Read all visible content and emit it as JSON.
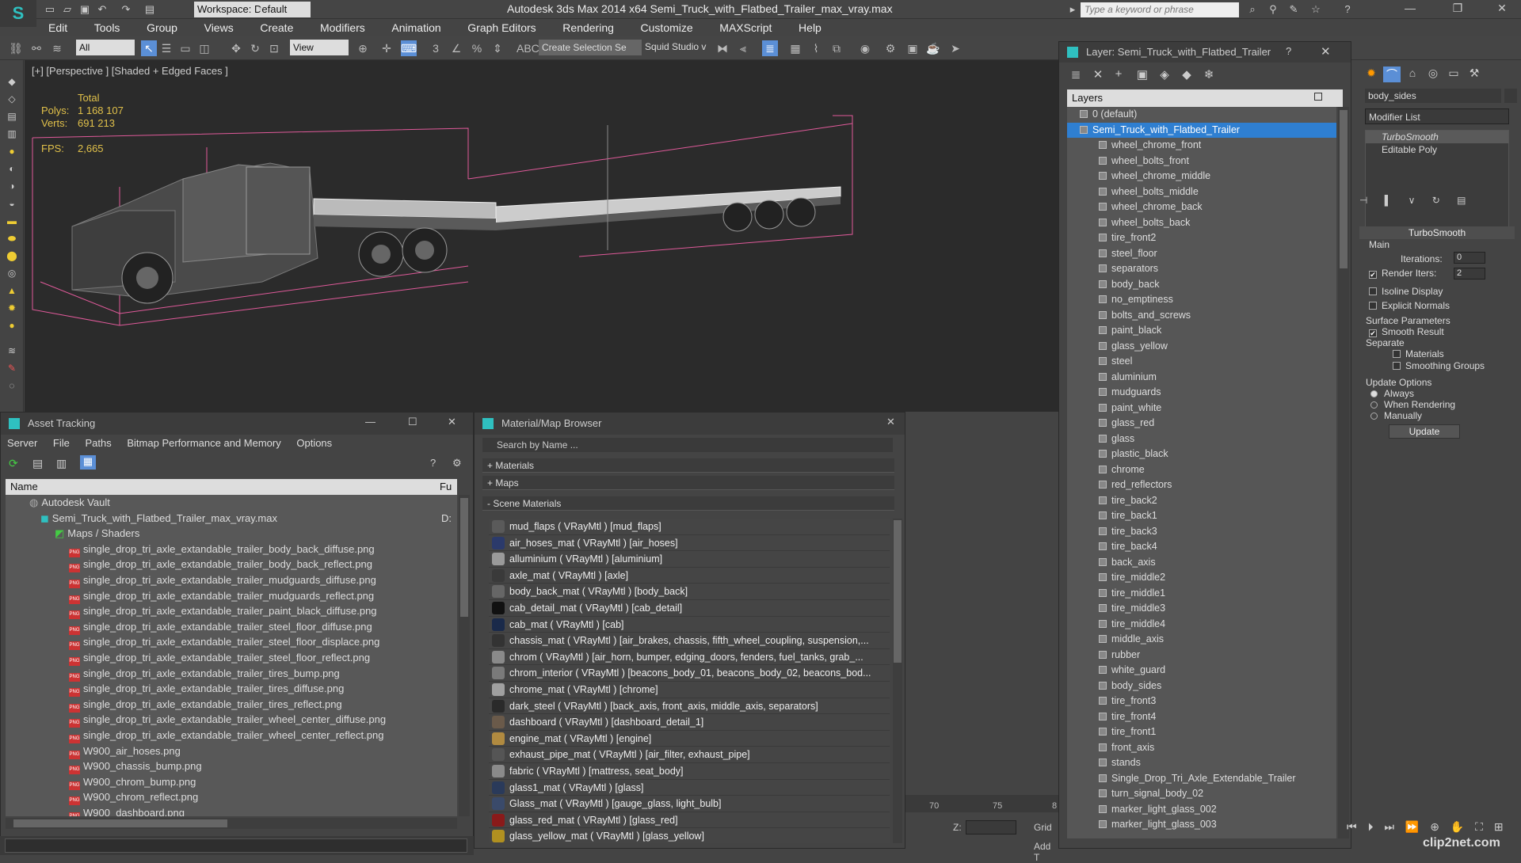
{
  "app": {
    "title": "Autodesk 3ds Max  2014 x64     Semi_Truck_with_Flatbed_Trailer_max_vray.max",
    "workspace": "Workspace: Default",
    "search_placeholder": "Type a keyword or phrase"
  },
  "menu": [
    "Edit",
    "Tools",
    "Group",
    "Views",
    "Create",
    "Modifiers",
    "Animation",
    "Graph Editors",
    "Rendering",
    "Customize",
    "MAXScript",
    "Help"
  ],
  "toolbar": {
    "filter": "All",
    "coord": "View",
    "selection_set": "Create Selection Se",
    "squid": "Squid Studio v"
  },
  "viewport": {
    "label": "[+] [Perspective ] [Shaded + Edged Faces ]",
    "stats_total": "Total",
    "polys_label": "Polys:",
    "polys": "1 168 107",
    "verts_label": "Verts:",
    "verts": "691 213",
    "fps_label": "FPS:",
    "fps": "2,665"
  },
  "layer_window": {
    "title": "Layer: Semi_Truck_with_Flatbed_Trailer",
    "header": "Layers",
    "top_items": [
      "0 (default)",
      "Semi_Truck_with_Flatbed_Trailer"
    ],
    "items": [
      "wheel_chrome_front",
      "wheel_bolts_front",
      "wheel_chrome_middle",
      "wheel_bolts_middle",
      "wheel_chrome_back",
      "wheel_bolts_back",
      "tire_front2",
      "steel_floor",
      "separators",
      "body_back",
      "no_emptiness",
      "bolts_and_screws",
      "paint_black",
      "glass_yellow",
      "steel",
      "aluminium",
      "mudguards",
      "paint_white",
      "glass_red",
      "glass",
      "plastic_black",
      "chrome",
      "red_reflectors",
      "tire_back2",
      "tire_back1",
      "tire_back3",
      "tire_back4",
      "back_axis",
      "tire_middle2",
      "tire_middle1",
      "tire_middle3",
      "tire_middle4",
      "middle_axis",
      "rubber",
      "white_guard",
      "body_sides",
      "tire_front3",
      "tire_front4",
      "tire_front1",
      "front_axis",
      "stands",
      "Single_Drop_Tri_Axle_Extendable_Trailer",
      "turn_signal_body_02",
      "marker_light_glass_002",
      "marker_light_glass_003"
    ]
  },
  "command_panel": {
    "object_name": "body_sides",
    "modifier_list": "Modifier List",
    "stack": [
      "TurboSmooth",
      "Editable Poly"
    ],
    "rollout_title": "TurboSmooth",
    "main_label": "Main",
    "iterations_label": "Iterations:",
    "iterations": "0",
    "render_iters_label": "Render Iters:",
    "render_iters": "2",
    "isoline": "Isoline Display",
    "explicit_normals": "Explicit Normals",
    "surface_params": "Surface Parameters",
    "smooth_result": "Smooth Result",
    "separate": "Separate",
    "materials": "Materials",
    "smoothing_groups": "Smoothing Groups",
    "update_options": "Update Options",
    "always": "Always",
    "when_rendering": "When Rendering",
    "manually": "Manually",
    "update_button": "Update"
  },
  "asset_tracking": {
    "title": "Asset Tracking",
    "menu": [
      "Server",
      "File",
      "Paths",
      "Bitmap Performance and Memory",
      "Options"
    ],
    "col_name": "Name",
    "col_fu": "Fu",
    "vault": "Autodesk Vault",
    "file": "Semi_Truck_with_Flatbed_Trailer_max_vray.max",
    "file_suffix": "D:",
    "maps_folder": "Maps / Shaders",
    "maps": [
      "single_drop_tri_axle_extandable_trailer_body_back_diffuse.png",
      "single_drop_tri_axle_extandable_trailer_body_back_reflect.png",
      "single_drop_tri_axle_extandable_trailer_mudguards_diffuse.png",
      "single_drop_tri_axle_extandable_trailer_mudguards_reflect.png",
      "single_drop_tri_axle_extandable_trailer_paint_black_diffuse.png",
      "single_drop_tri_axle_extandable_trailer_steel_floor_diffuse.png",
      "single_drop_tri_axle_extandable_trailer_steel_floor_displace.png",
      "single_drop_tri_axle_extandable_trailer_steel_floor_reflect.png",
      "single_drop_tri_axle_extandable_trailer_tires_bump.png",
      "single_drop_tri_axle_extandable_trailer_tires_diffuse.png",
      "single_drop_tri_axle_extandable_trailer_tires_reflect.png",
      "single_drop_tri_axle_extandable_trailer_wheel_center_diffuse.png",
      "single_drop_tri_axle_extandable_trailer_wheel_center_reflect.png",
      "W900_air_hoses.png",
      "W900_chassis_bump.png",
      "W900_chrom_bump.png",
      "W900_chrom_reflect.png",
      "W900_dashboard.png"
    ]
  },
  "material_browser": {
    "title": "Material/Map Browser",
    "search": "Search by Name ...",
    "cat_materials": "+ Materials",
    "cat_maps": "+ Maps",
    "cat_scene": "- Scene Materials",
    "items": [
      {
        "t": "mud_flaps  ( VRayMtl ) [mud_flaps]",
        "c": "#5a5a5a"
      },
      {
        "t": "air_hoses_mat  ( VRayMtl ) [air_hoses]",
        "c": "#2b3a6b"
      },
      {
        "t": "alluminium  ( VRayMtl ) [aluminium]",
        "c": "#9a9a9a"
      },
      {
        "t": "axle_mat  ( VRayMtl ) [axle]",
        "c": "#3a3a3a"
      },
      {
        "t": "body_back_mat  ( VRayMtl ) [body_back]",
        "c": "#666666"
      },
      {
        "t": "cab_detail_mat  ( VRayMtl ) [cab_detail]",
        "c": "#111111"
      },
      {
        "t": "cab_mat  ( VRayMtl ) [cab]",
        "c": "#1a2a4a"
      },
      {
        "t": "chassis_mat  ( VRayMtl ) [air_brakes, chassis, fifth_wheel_coupling, suspension,...",
        "c": "#333333"
      },
      {
        "t": "chrom  ( VRayMtl ) [air_horn, bumper, edging_doors, fenders, fuel_tanks, grab_...",
        "c": "#8a8a8a"
      },
      {
        "t": "chrom_interior  ( VRayMtl ) [beacons_body_01, beacons_body_02, beacons_bod...",
        "c": "#7a7a7a"
      },
      {
        "t": "chrome_mat  ( VRayMtl ) [chrome]",
        "c": "#a0a0a0"
      },
      {
        "t": "dark_steel  ( VRayMtl ) [back_axis, front_axis, middle_axis, separators]",
        "c": "#2a2a2a"
      },
      {
        "t": "dashboard  ( VRayMtl ) [dashboard_detail_1]",
        "c": "#6a5a4a"
      },
      {
        "t": "engine_mat  ( VRayMtl ) [engine]",
        "c": "#b08a40"
      },
      {
        "t": "exhaust_pipe_mat  ( VRayMtl ) [air_filter, exhaust_pipe]",
        "c": "#555555"
      },
      {
        "t": "fabric  ( VRayMtl ) [mattress, seat_body]",
        "c": "#8a8a8a"
      },
      {
        "t": "glass1_mat  ( VRayMtl ) [glass]",
        "c": "#2a3a5a"
      },
      {
        "t": "Glass_mat  ( VRayMtl ) [gauge_glass, light_bulb]",
        "c": "#3a4a6a"
      },
      {
        "t": "glass_red_mat  ( VRayMtl ) [glass_red]",
        "c": "#8a1a1a"
      },
      {
        "t": "glass_yellow_mat  ( VRayMtl ) [glass_yellow]",
        "c": "#b09020"
      }
    ]
  },
  "timeline": {
    "tick70": "70",
    "tick75": "75",
    "tick8": "8",
    "z_label": "Z:",
    "grid": "Grid",
    "add": "Add T"
  },
  "watermark": "clip2net.com",
  "colors": {
    "selection": "#2f7fd1",
    "stats": "#e0c04a",
    "bbox": "#e05a9a"
  }
}
